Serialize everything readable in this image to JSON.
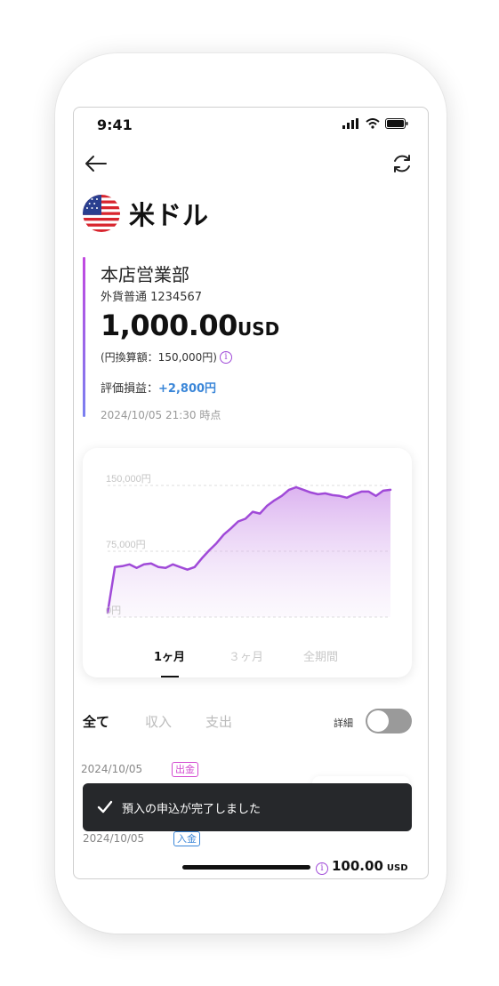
{
  "status_bar": {
    "time": "9:41"
  },
  "header": {
    "back_icon": "arrow-left-icon",
    "refresh_icon": "refresh-icon"
  },
  "currency": {
    "flag_icon": "us-flag-icon",
    "title": "米ドル"
  },
  "account": {
    "branch": "本店営業部",
    "type_number": "外貨普通 1234567",
    "amount": "1,000.00",
    "unit": "USD",
    "yen_equivalent": "(円換算額：150,000円)",
    "pl_label": "評価損益：",
    "pl_value": "+2,800円",
    "timestamp": "2024/10/05 21:30 時点"
  },
  "colors": {
    "accent_purple": "#a04ad8",
    "accent_blue": "#3a86d8",
    "toast_bg": "#26282b"
  },
  "chart_data": {
    "type": "area",
    "y_tick_labels": [
      "150,000円",
      "75,000円",
      "0円"
    ],
    "ylim": [
      0,
      150000
    ],
    "grid": true,
    "legend": "none",
    "series": [
      {
        "values": [
          5000,
          57000,
          58000,
          60000,
          56000,
          60000,
          61000,
          57000,
          56000,
          60000,
          57000,
          54000,
          57000,
          67000,
          76000,
          84000,
          94000,
          101000,
          109000,
          112000,
          120000,
          118000,
          127000,
          133000,
          138000,
          145000,
          148000,
          145000,
          142000,
          140000,
          141000,
          139000,
          138000,
          136000,
          140000,
          143000,
          143000,
          138000,
          144000,
          145000
        ]
      }
    ],
    "range_tabs": [
      "1ヶ月",
      "３ヶ月",
      "全期間"
    ],
    "active_range": "1ヶ月"
  },
  "filters": {
    "tabs": [
      "全て",
      "収入",
      "支出"
    ],
    "active": "全て",
    "detail_label": "詳細"
  },
  "transactions": [
    {
      "date": "2024/10/05",
      "badge": "出金"
    },
    {
      "date": "2024/10/05",
      "badge": "入金"
    }
  ],
  "toast": {
    "check_icon": "check-icon",
    "message": "預入の申込が完了しました"
  },
  "last_amount": {
    "value": "100.00",
    "unit": "USD"
  }
}
